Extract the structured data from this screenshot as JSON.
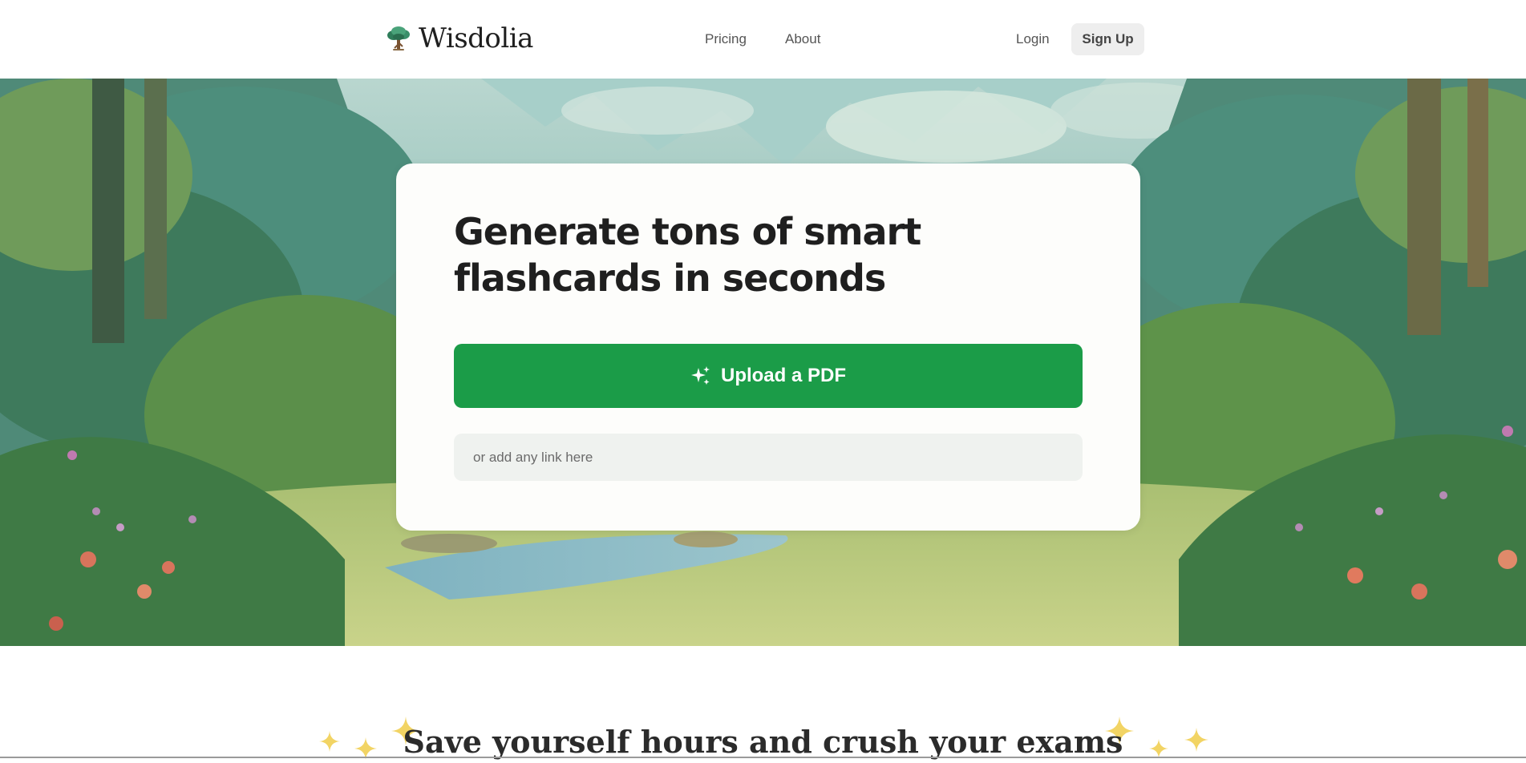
{
  "brand": {
    "name": "Wisdolia",
    "logo_icon": "tree-icon"
  },
  "nav": {
    "pricing": "Pricing",
    "about": "About",
    "login": "Login",
    "signup": "Sign Up"
  },
  "hero": {
    "title": "Generate tons of smart flashcards in seconds",
    "upload_label": "Upload a PDF",
    "upload_icon": "sparkle-icon",
    "link_placeholder": "or add any link here"
  },
  "section": {
    "title": "Save yourself hours and crush your exams"
  },
  "colors": {
    "accent": "#1b9c48",
    "star": "#f2d464",
    "input_bg": "#eff2ef",
    "signup_bg": "#eeeeee"
  }
}
